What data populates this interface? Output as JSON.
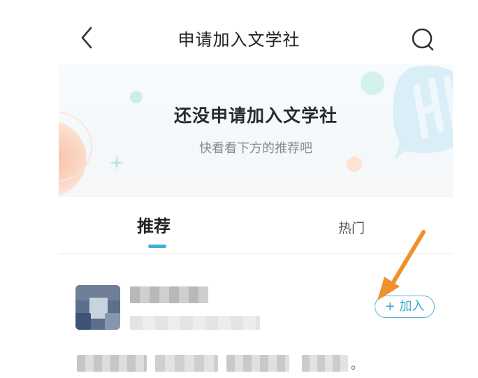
{
  "nav": {
    "title": "申请加入文学社",
    "back_icon": "chevron-left-icon",
    "search_icon": "search-icon"
  },
  "banner": {
    "title": "还没申请加入文学社",
    "subtitle": "快看看下方的推荐吧"
  },
  "tabs": [
    {
      "label": "推荐",
      "active": true
    },
    {
      "label": "热门",
      "active": false
    }
  ],
  "club": {
    "join_label": "+ 加入",
    "desc_end": "。"
  },
  "colors": {
    "accent": "#3fb0d8",
    "annotation_arrow": "#f0922c",
    "text_primary": "#222222",
    "text_secondary": "#8a8a8a"
  }
}
